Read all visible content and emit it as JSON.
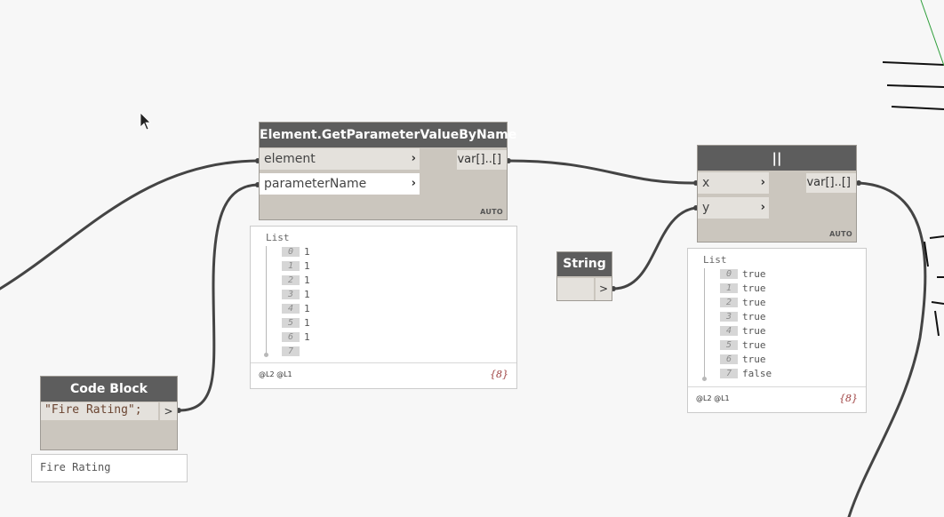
{
  "canvas": {
    "background": "#f7f7f7",
    "wire_color": "#444444"
  },
  "get_param_node": {
    "title": "Element.GetParameterValueByName",
    "inputs": [
      {
        "label": "element",
        "chevron": "›"
      },
      {
        "label": "parameterName",
        "chevron": "›"
      }
    ],
    "output": "var[]..[]",
    "lacing": "AUTO",
    "preview": {
      "header": "List",
      "items": [
        {
          "index": "0",
          "value": "1"
        },
        {
          "index": "1",
          "value": "1"
        },
        {
          "index": "2",
          "value": "1"
        },
        {
          "index": "3",
          "value": "1"
        },
        {
          "index": "4",
          "value": "1"
        },
        {
          "index": "5",
          "value": "1"
        },
        {
          "index": "6",
          "value": "1"
        },
        {
          "index": "7",
          "value": ""
        }
      ],
      "levels": "@L2 @L1",
      "count": "{8}"
    }
  },
  "or_node": {
    "title": "||",
    "inputs": [
      {
        "label": "x",
        "chevron": "›"
      },
      {
        "label": "y",
        "chevron": "›"
      }
    ],
    "output": "var[]..[]",
    "lacing": "AUTO",
    "preview": {
      "header": "List",
      "items": [
        {
          "index": "0",
          "value": "true"
        },
        {
          "index": "1",
          "value": "true"
        },
        {
          "index": "2",
          "value": "true"
        },
        {
          "index": "3",
          "value": "true"
        },
        {
          "index": "4",
          "value": "true"
        },
        {
          "index": "5",
          "value": "true"
        },
        {
          "index": "6",
          "value": "true"
        },
        {
          "index": "7",
          "value": "false"
        }
      ],
      "levels": "@L2 @L1",
      "count": "{8}"
    }
  },
  "string_node": {
    "title": "String",
    "output": ">"
  },
  "code_block_node": {
    "title": "Code Block",
    "code": "\"Fire Rating\";",
    "output": ">",
    "preview_value": "Fire Rating"
  },
  "cursor": {
    "icon": "arrow-cursor-icon"
  }
}
